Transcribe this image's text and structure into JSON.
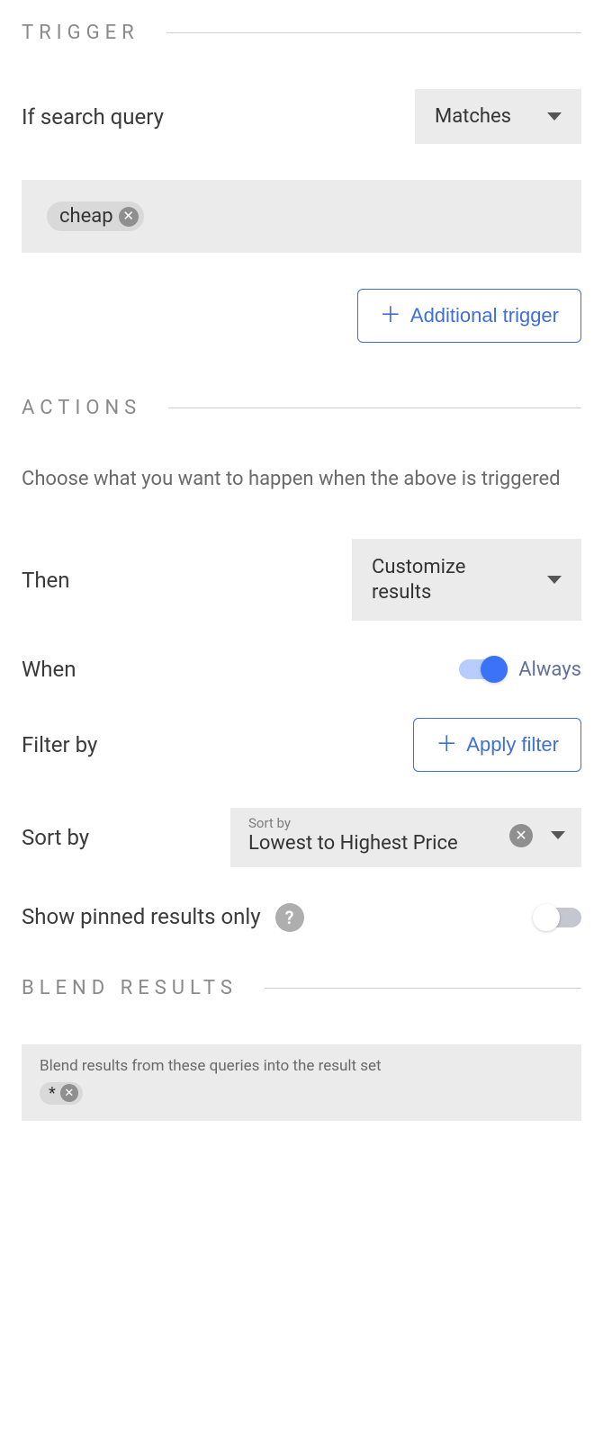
{
  "sections": {
    "trigger": {
      "title": "TRIGGER"
    },
    "actions": {
      "title": "ACTIONS"
    },
    "blend": {
      "title": "BLEND RESULTS"
    }
  },
  "trigger": {
    "condition_label": "If search query",
    "select_value": "Matches",
    "tag_value": "cheap",
    "additional_btn": "Additional trigger"
  },
  "actions": {
    "description": "Choose what you want to happen when the above is triggered",
    "then_label": "Then",
    "then_value": "Customize results",
    "when_label": "When",
    "when_value": "Always",
    "filter_label": "Filter by",
    "filter_btn": "Apply filter",
    "sort_label": "Sort by",
    "sort_field_label": "Sort by",
    "sort_value": "Lowest to Highest Price",
    "pinned_label": "Show pinned results only"
  },
  "blend": {
    "description": "Blend results from these queries into the result set",
    "tag_value": "*"
  }
}
